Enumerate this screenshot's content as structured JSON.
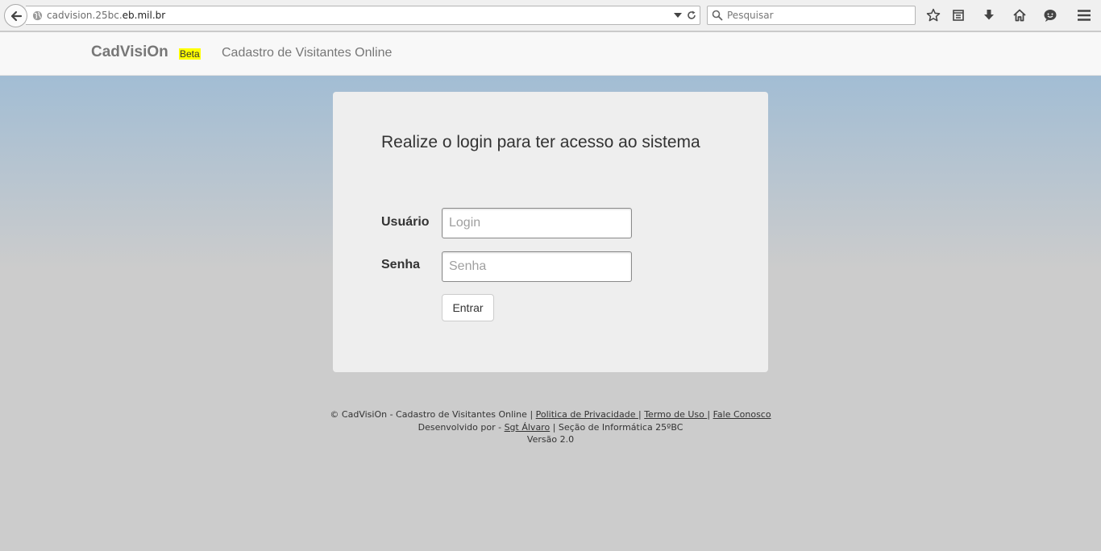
{
  "browser": {
    "url_prefix": "cadvision.25bc.",
    "url_domain": "eb.mil.br",
    "search_placeholder": "Pesquisar"
  },
  "navbar": {
    "brand": "CadVisiOn",
    "badge": "Beta",
    "subtitle": "Cadastro de Visitantes Online"
  },
  "login": {
    "title": "Realize o login para ter acesso ao sistema",
    "user_label": "Usuário",
    "user_placeholder": "Login",
    "password_label": "Senha",
    "password_placeholder": "Senha",
    "submit_label": "Entrar"
  },
  "footer": {
    "copyright": "© CadVisiOn - Cadastro de Visitantes Online",
    "sep": "|",
    "privacy": "Politica de Privacidade ",
    "terms": "Termo de Uso ",
    "contact": "Fale Conosco",
    "developed_by": "Desenvolvido por -",
    "developer": "Sgt Álvaro",
    "section": "| Seção de Informática 25ºBC",
    "version": "Versão 2.0"
  },
  "colors": {
    "gradient_top": "#a2bdd4",
    "background": "#cccccc",
    "card": "#eeeeee",
    "badge": "#ffff00"
  },
  "icons": [
    "back-arrow-icon",
    "globe-icon",
    "dropdown-arrow-icon",
    "reload-icon",
    "search-icon",
    "bookmark-star-icon",
    "reading-list-icon",
    "download-icon",
    "home-icon",
    "chat-icon",
    "hamburger-menu-icon"
  ]
}
